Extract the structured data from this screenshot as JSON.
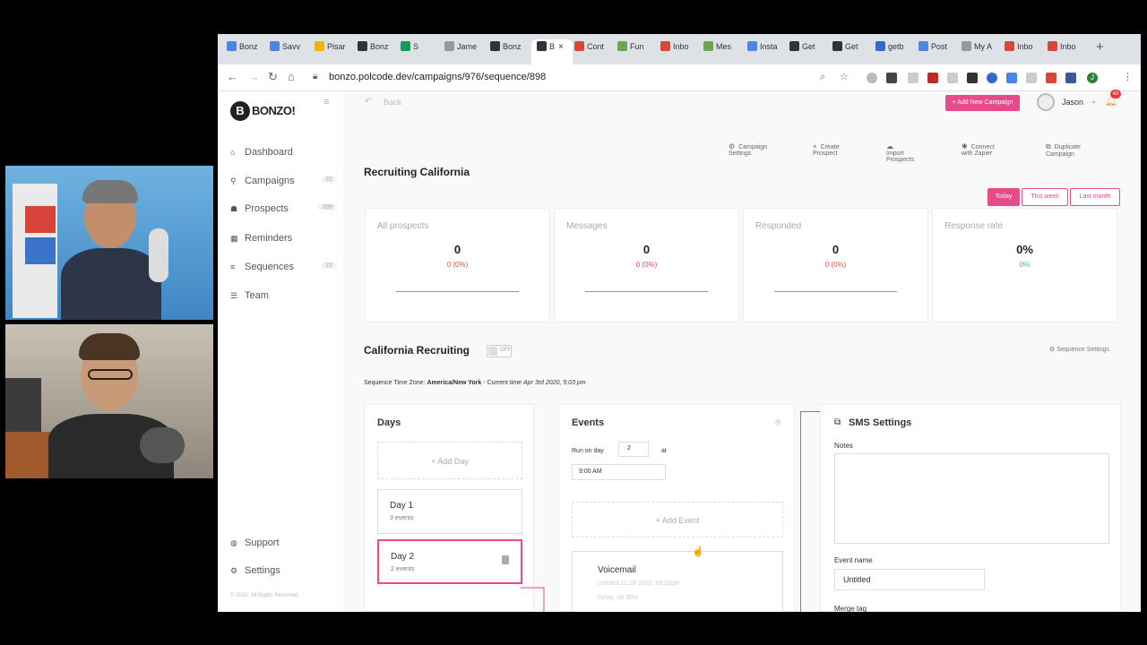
{
  "browser": {
    "tabs": [
      {
        "label": "Bonz",
        "color": "#4a86e8"
      },
      {
        "label": "Savv",
        "color": "#4a86e8"
      },
      {
        "label": "Pisar",
        "color": "#f4b400"
      },
      {
        "label": "Bonz",
        "color": "#333333"
      },
      {
        "label": "S",
        "color": "#0f9d58"
      },
      {
        "label": "Jame",
        "color": "#999999"
      },
      {
        "label": "Bonz",
        "color": "#333333"
      },
      {
        "label": "B",
        "color": "#333333"
      },
      {
        "label": "Cont",
        "color": "#db4437"
      },
      {
        "label": "Fun",
        "color": "#6aa84f"
      },
      {
        "label": "Inbo",
        "color": "#db4437"
      },
      {
        "label": "Mes",
        "color": "#6aa84f"
      },
      {
        "label": "Insta",
        "color": "#4a86e8"
      },
      {
        "label": "Get",
        "color": "#333333"
      },
      {
        "label": "Get",
        "color": "#333333"
      },
      {
        "label": "getb",
        "color": "#3367d6"
      },
      {
        "label": "Post",
        "color": "#4a86e8"
      },
      {
        "label": "My A",
        "color": "#999999"
      },
      {
        "label": "Inbo",
        "color": "#db4437"
      },
      {
        "label": "Inbo",
        "color": "#db4437"
      }
    ],
    "new_tab": "+",
    "close_tab": "×",
    "url": "bonzo.polcode.dev/campaigns/976/sequence/898",
    "profile_initial": "J"
  },
  "app": {
    "logo_mark": "B",
    "logo_text": "BONZO!",
    "back_label": "Back",
    "add_campaign_label": "+ Add New Campaign",
    "user_name": "Jason",
    "notification_count": "43",
    "nav": [
      {
        "label": "Dashboard",
        "icon": "home-icon",
        "glyph": "⌂",
        "count": ""
      },
      {
        "label": "Campaigns",
        "icon": "sitemap-icon",
        "glyph": "⚲",
        "count": "22"
      },
      {
        "label": "Prospects",
        "icon": "users-icon",
        "glyph": "☗",
        "count": "399"
      },
      {
        "label": "Reminders",
        "icon": "calendar-icon",
        "glyph": "▦",
        "count": ""
      },
      {
        "label": "Sequences",
        "icon": "list-icon",
        "glyph": "≡",
        "count": "22"
      },
      {
        "label": "Team",
        "icon": "team-icon",
        "glyph": "☰",
        "count": ""
      }
    ],
    "support_label": "Support",
    "settings_label": "Settings",
    "copyright": "© 2020. All Rights Reserved"
  },
  "campaign": {
    "toolbar": [
      "Campaign Settings",
      "Create Prospect",
      "Import Prospects",
      "Connect with Zapier",
      "Duplicate Campaign"
    ],
    "title": "Recruiting California",
    "periods": [
      "Today",
      "This week",
      "Last month"
    ],
    "stats": [
      {
        "label": "All prospects",
        "value": "0",
        "sub": "0 (0%)",
        "sub_color": "#d9534f"
      },
      {
        "label": "Messages",
        "value": "0",
        "sub": "0 (0%)",
        "sub_color": "#d9534f"
      },
      {
        "label": "Responded",
        "value": "0",
        "sub": "0 (0%)",
        "sub_color": "#d9534f"
      },
      {
        "label": "Response rate",
        "value": "0%",
        "sub": "0%",
        "sub_color": "#5cb85c"
      }
    ]
  },
  "sequence": {
    "title": "California Recruiting",
    "toggle_label": "OFF",
    "settings_label": "Sequence Settings",
    "tz_prefix": "Sequence Time Zone:",
    "tz_value": "America/New York",
    "time_prefix": "- Current time",
    "time_value": "Apr 3rd 2020, 5:03 pm"
  },
  "days": {
    "heading": "Days",
    "add_label": "+ Add Day",
    "items": [
      {
        "title": "Day 1",
        "sub": "3 events"
      },
      {
        "title": "Day 2",
        "sub": "2 events"
      }
    ]
  },
  "events": {
    "heading": "Events",
    "run_on_label": "Run on day",
    "run_day_value": "2",
    "at_label": "at",
    "time_value": "9:00 AM",
    "add_label": "+ Add Event",
    "items": [
      {
        "title": "Voicemail",
        "line1": "Untitled 11:19-2020, 05:03pm",
        "line2": "Delay: 0h 00m"
      }
    ]
  },
  "sms": {
    "heading": "SMS Settings",
    "notes_label": "Notes",
    "notes_value": "",
    "event_name_label": "Event name",
    "event_name_value": "Untitled",
    "merge_tag_label": "Merge tag"
  },
  "colors": {
    "accent": "#e84a8a",
    "danger": "#d9534f",
    "success": "#5cb85c"
  }
}
